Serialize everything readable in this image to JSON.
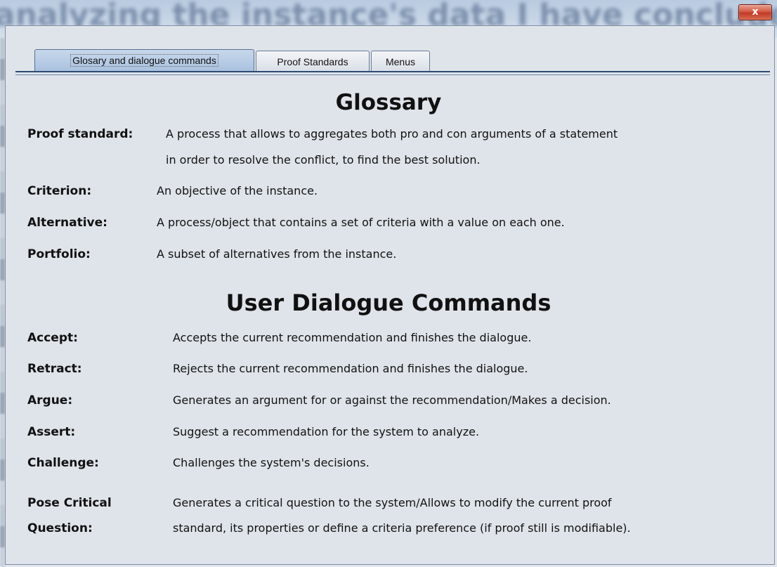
{
  "window": {
    "blurred_title": "analyzing the instance's data I have concluded",
    "close_label": "x"
  },
  "tabs": [
    {
      "label": "Glosary and dialogue commands",
      "active": true
    },
    {
      "label": "Proof Standards",
      "active": false
    },
    {
      "label": "Menus",
      "active": false
    }
  ],
  "glossary": {
    "heading": "Glossary",
    "entries": [
      {
        "term": "Proof standard:",
        "definition_lines": [
          "A process that allows to aggregates both pro and con arguments of a statement",
          "in order to resolve the conflict, to find the best solution."
        ]
      },
      {
        "term": "Criterion:",
        "definition_lines": [
          "An objective of the instance."
        ]
      },
      {
        "term": "Alternative:",
        "definition_lines": [
          "A process/object that contains a set of criteria with a value on each one."
        ]
      },
      {
        "term": "Portfolio:",
        "definition_lines": [
          "A subset of alternatives from the instance."
        ]
      }
    ]
  },
  "commands": {
    "heading": "User Dialogue Commands",
    "entries": [
      {
        "term_lines": [
          "Accept:"
        ],
        "definition_lines": [
          "Accepts the current recommendation and finishes the dialogue."
        ]
      },
      {
        "term_lines": [
          "Retract:"
        ],
        "definition_lines": [
          "Rejects the current recommendation and finishes the dialogue."
        ]
      },
      {
        "term_lines": [
          "Argue:"
        ],
        "definition_lines": [
          "Generates an argument for or against the recommendation/Makes a decision."
        ]
      },
      {
        "term_lines": [
          "Assert:"
        ],
        "definition_lines": [
          "Suggest a recommendation for the system to analyze."
        ]
      },
      {
        "term_lines": [
          "Challenge:"
        ],
        "definition_lines": [
          "Challenges the system's decisions."
        ]
      },
      {
        "term_lines": [
          "Pose Critical",
          "Question:"
        ],
        "definition_lines": [
          "Generates a critical question to the system/Allows to modify the current proof",
          "standard, its properties or define a criteria preference (if proof still is modifiable)."
        ]
      }
    ]
  }
}
